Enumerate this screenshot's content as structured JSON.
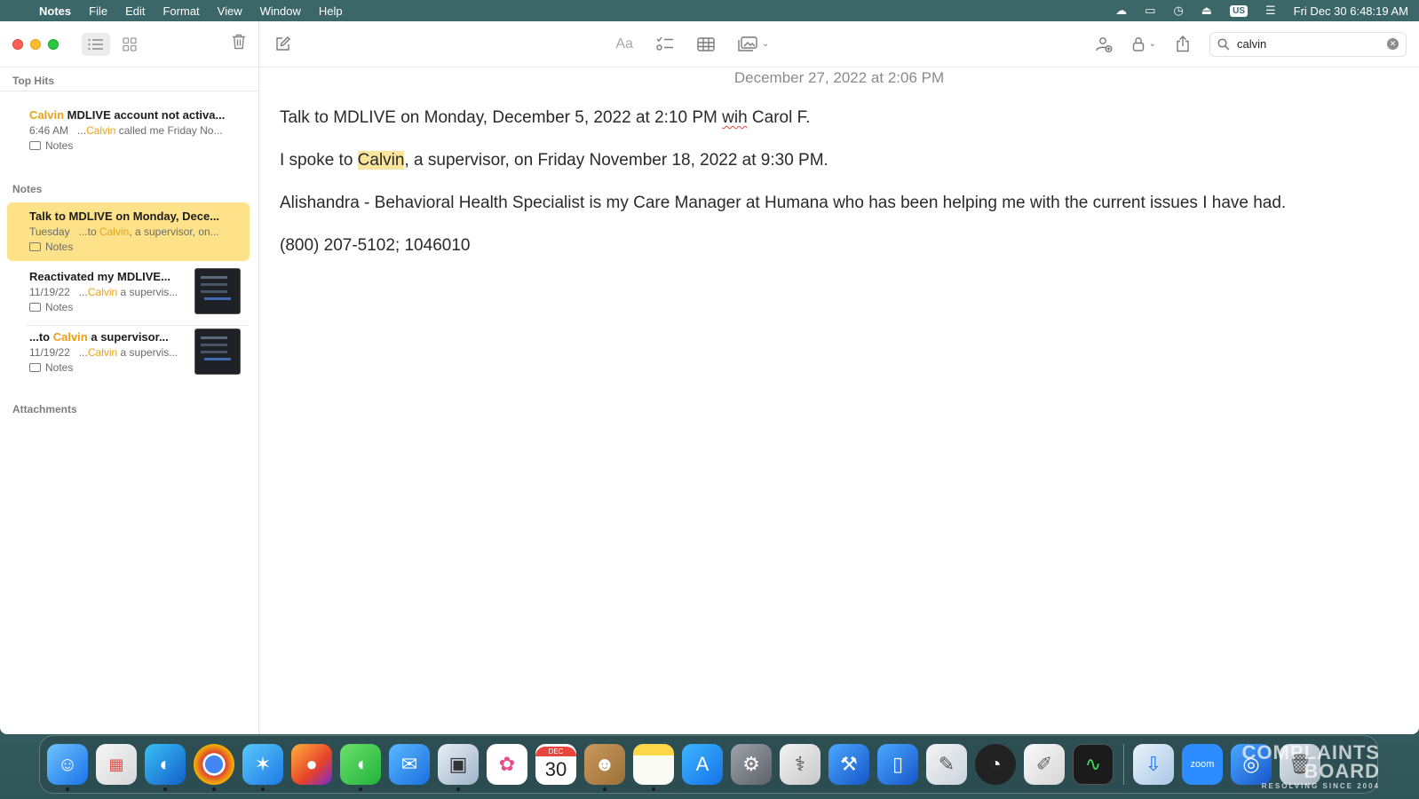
{
  "menubar": {
    "app_name": "Notes",
    "menus": [
      "File",
      "Edit",
      "Format",
      "View",
      "Window",
      "Help"
    ],
    "input_source": "US",
    "clock": "Fri Dec 30  6:48:19 AM"
  },
  "sidebar": {
    "sections": {
      "top_hits": "Top Hits",
      "notes": "Notes",
      "attachments": "Attachments"
    },
    "top_hits": [
      {
        "title_hl": "Calvin",
        "title_rest": " MDLIVE account not activa...",
        "time": "6:46 AM",
        "snippet_pre": "...",
        "snippet_hl": "Calvin",
        "snippet_post": " called me Friday No...",
        "folder": "Notes"
      }
    ],
    "notes": [
      {
        "title_pre": "Talk to MDLIVE on Monday, Dece...",
        "time": "Tuesday",
        "snippet_pre": "...to ",
        "snippet_hl": "Calvin",
        "snippet_post": ", a supervisor, on...",
        "folder": "Notes"
      },
      {
        "title_pre": "Reactivated my MDLIVE...",
        "time": "11/19/22",
        "snippet_pre": "...",
        "snippet_hl": "Calvin",
        "snippet_post": " a supervis...",
        "folder": "Notes"
      },
      {
        "title_pre": "...to ",
        "title_hl": "Calvin",
        "title_post": " a supervisor...",
        "time": "11/19/22",
        "snippet_pre": "...",
        "snippet_hl": "Calvin",
        "snippet_post": " a supervis...",
        "folder": "Notes"
      }
    ]
  },
  "toolbar": {
    "format_label": "Aa",
    "search_value": "calvin"
  },
  "note": {
    "date": "December 27, 2022 at 2:06 PM",
    "line1_pre": "Talk to MDLIVE on Monday, December 5, 2022 at 2:10 PM ",
    "line1_misspelled": "wih",
    "line1_post": " Carol F.",
    "line2_pre": "I spoke to ",
    "line2_match": "Calvin",
    "line2_post": ", a supervisor, on Friday November 18, 2022 at 9:30 PM.",
    "line3": "Alishandra -  Behavioral Health Specialist is my Care Manager at Humana who has been helping me with the current issues I have had.",
    "line4": "(800) 207-5102; 1046010"
  },
  "dock": {
    "calendar_month": "DEC",
    "calendar_day": "30",
    "zoom_label": "zoom"
  },
  "watermark": {
    "line1": "COMPLAINTS",
    "line2": "BOARD",
    "line3": "RESOLVING SINCE 2004"
  }
}
